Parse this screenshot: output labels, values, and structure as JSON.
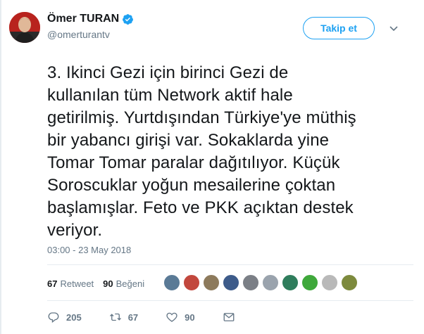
{
  "author": {
    "name": "Ömer TURAN",
    "handle": "@omerturantv"
  },
  "follow_label": "Takip et",
  "tweet": {
    "lines": [
      "3. Ikinci Gezi için birinci Gezi de",
      "kullanılan tüm Network aktif hale",
      "getirilmiş. Yurtdışından Türkiye'ye müthiş",
      "bir yabancı girişi var. Sokaklarda yine",
      "Tomar Tomar paralar dağıtılıyor. Küçük",
      "Soroscuklar yoğun mesailerine çoktan",
      "başlamışlar. Feto ve PKK açıktan destek",
      "veriyor."
    ],
    "timestamp": "03:00 - 23 May 2018"
  },
  "stats": {
    "retweet_count": "67",
    "retweet_label": "Retweet",
    "like_count": "90",
    "like_label": "Beğeni"
  },
  "liker_avatars": [
    "#5a7a96",
    "#c2473d",
    "#8d7a5c",
    "#3d5b8a",
    "#7b7f86",
    "#9aa3ad",
    "#2f7d5c",
    "#3fa83b",
    "#b9b9b9",
    "#7d8a3d"
  ],
  "actions": {
    "reply_count": "205",
    "retweet_count": "67",
    "like_count": "90"
  },
  "colors": {
    "accent": "#1da1f2",
    "muted": "#657786",
    "text": "#14171a"
  }
}
